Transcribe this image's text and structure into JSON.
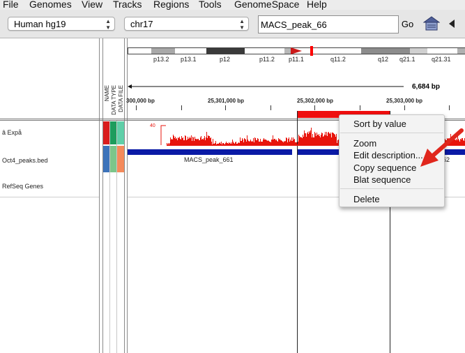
{
  "menu": [
    "File",
    "Genomes",
    "View",
    "Tracks",
    "Regions",
    "Tools",
    "GenomeSpace",
    "Help"
  ],
  "toolbar": {
    "genome": "Human hg19",
    "chromosome": "chr17",
    "locus": "MACS_peak_66",
    "go_label": "Go",
    "home_icon": "home-icon",
    "back_icon": "back-arrow-icon"
  },
  "ideogram": {
    "bands": [
      "p13.2",
      "p13.1",
      "p12",
      "p11.2",
      "p11.1",
      "q11.2",
      "q12",
      "q21.1",
      "q21.31"
    ]
  },
  "ruler": {
    "span_label": "6,684 bp",
    "labels": [
      "300,000 bp",
      "25,301,000 bp",
      "25,302,000 bp",
      "25,303,000 bp"
    ]
  },
  "attribute_headers": [
    "NAME",
    "DATA TYPE",
    "DATA FILE"
  ],
  "tracks": [
    {
      "name": "â   Expå"
    },
    {
      "name": "Oct4_peaks.bed"
    },
    {
      "name": "RefSeq Genes"
    }
  ],
  "signal": {
    "scale_label": "40",
    "color": "#e8140c"
  },
  "features": [
    {
      "label": "MACS_peak_661"
    },
    {
      "label": "62"
    }
  ],
  "context_menu": {
    "items": [
      "Sort by value",
      "Zoom",
      "Edit description...",
      "Copy sequence",
      "Blat sequence",
      "Delete"
    ]
  },
  "colors": {
    "feature_blue": "#0a1aa6",
    "highlight_red": "#ef0d0d",
    "annotation_arrow": "#e0261c"
  }
}
